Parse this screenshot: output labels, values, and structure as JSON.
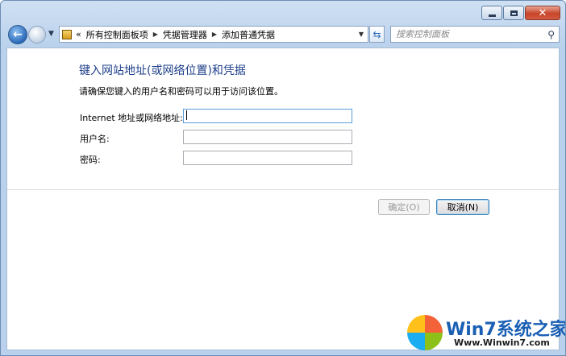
{
  "window": {
    "minimize_label": "minimize",
    "maximize_label": "maximize",
    "close_label": "close"
  },
  "nav": {
    "breadcrumb_overflow": "«",
    "crumbs": [
      "所有控制面板项",
      "凭据管理器",
      "添加普通凭据"
    ],
    "search_placeholder": "搜索控制面板"
  },
  "page": {
    "heading": "键入网站地址(或网络位置)和凭据",
    "description": "请确保您键入的用户名和密码可以用于访问该位置。"
  },
  "form": {
    "address_label": "Internet 地址或网络地址:",
    "address_value": "",
    "username_label": "用户名:",
    "username_value": "",
    "password_label": "密码:",
    "password_value": ""
  },
  "buttons": {
    "ok_label": "确定(O)",
    "cancel_label": "取消(N)"
  },
  "watermark": {
    "title": "Win7系统之家",
    "url": "Www.Winwin7.com"
  },
  "icons": {
    "back": "back-arrow-icon",
    "forward": "forward-arrow-icon",
    "control_panel": "control-panel-icon",
    "refresh": "refresh-icon",
    "search": "search-icon"
  }
}
